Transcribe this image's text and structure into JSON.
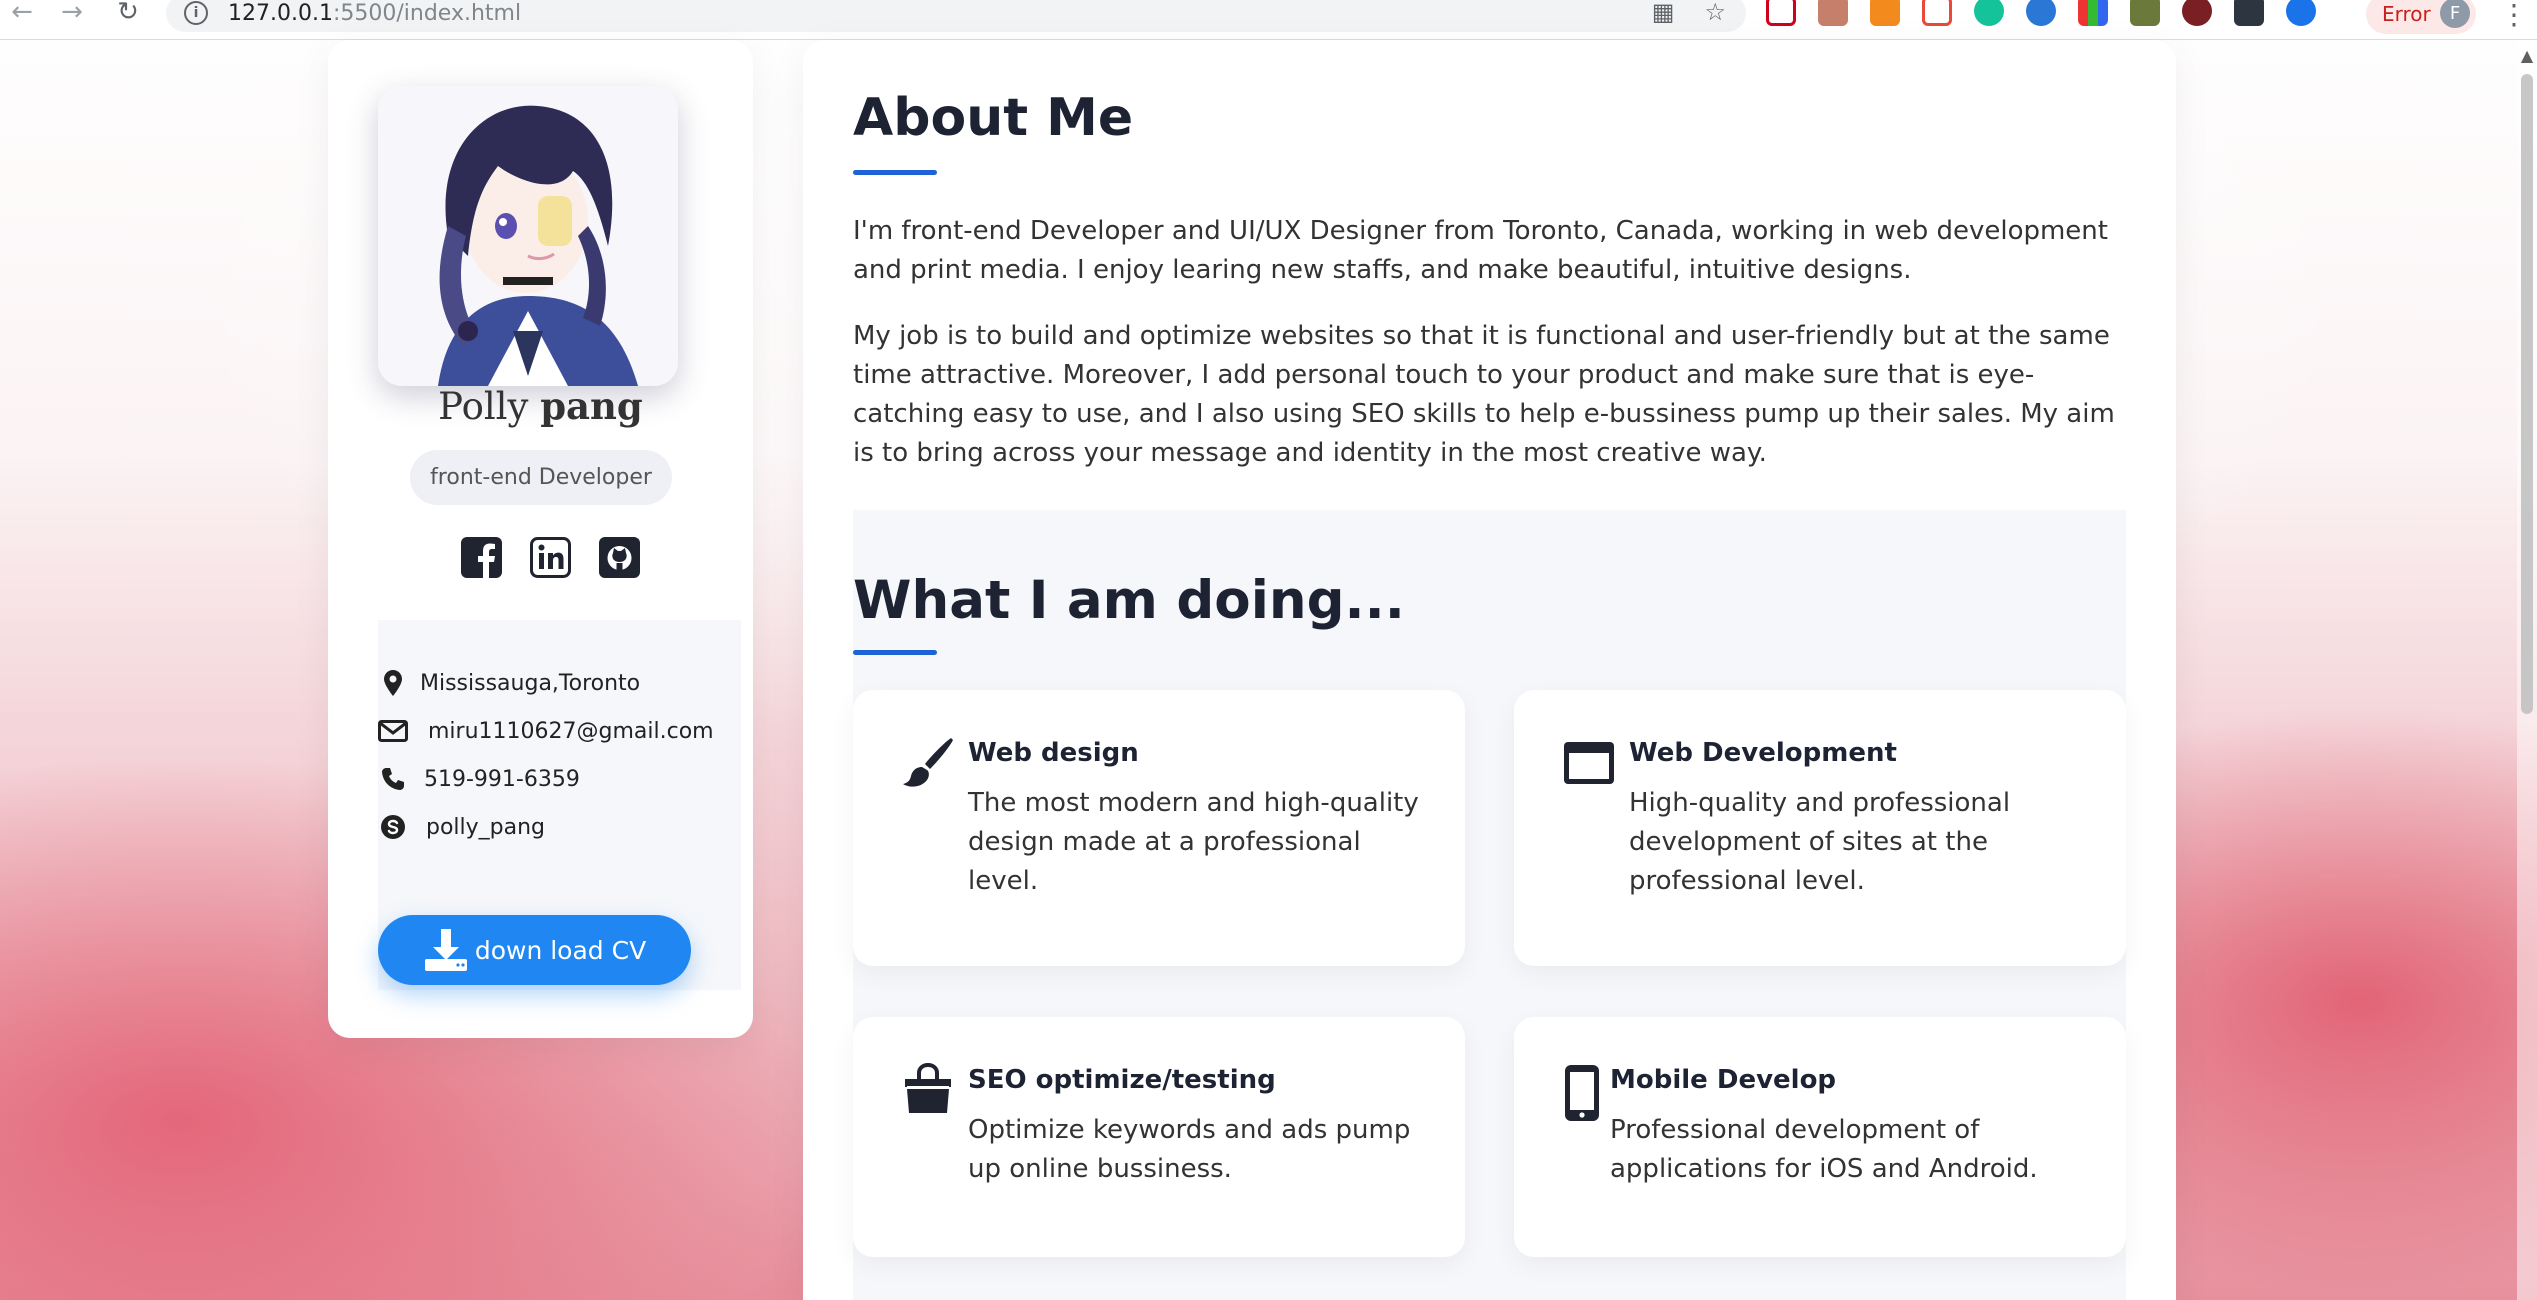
{
  "browser": {
    "url_host": "127.0.0.1",
    "url_rest": ":5500/index.html",
    "error_label": "Error",
    "profile_initial": "F"
  },
  "profile": {
    "first_name": "Polly",
    "last_name": "pang",
    "role": "front-end Developer",
    "social_icons": [
      "facebook-icon",
      "linkedin-icon",
      "github-icon"
    ]
  },
  "contact": {
    "location": "Mississauga,Toronto",
    "email": "miru1110627@gmail.com",
    "phone": "519-991-6359",
    "skype": "polly_pang",
    "cv_button": "down load CV"
  },
  "about": {
    "title": "About Me",
    "p1": "I'm front-end Developer and UI/UX Designer from Toronto, Canada, working in web development and print media. I enjoy learing new staffs, and make beautiful, intuitive designs.",
    "p2": "My job is to build and optimize websites so that it is functional and user-friendly but at the same time attractive. Moreover, I add personal touch to your product and make sure that is eye-catching easy to use, and I also using SEO skills to help e-bussiness pump up their sales. My aim is to bring across your message and identity in the most creative way."
  },
  "doing": {
    "title": "What I am doing...",
    "services": [
      {
        "icon": "paintbrush-icon",
        "title": "Web design",
        "desc": "The most modern and high-quality design made at a professional level."
      },
      {
        "icon": "browser-window-icon",
        "title": "Web Development",
        "desc": "High-quality and professional development of sites at the professional level."
      },
      {
        "icon": "shopping-bag-icon",
        "title": "SEO optimize/testing",
        "desc": "Optimize keywords and ads pump up online bussiness."
      },
      {
        "icon": "mobile-phone-icon",
        "title": "Mobile Develop",
        "desc": "Professional development of applications for iOS and Android."
      }
    ]
  },
  "colors": {
    "accent": "#1e63d6",
    "button": "#1f86f2",
    "panel": "#f6f7fa"
  }
}
